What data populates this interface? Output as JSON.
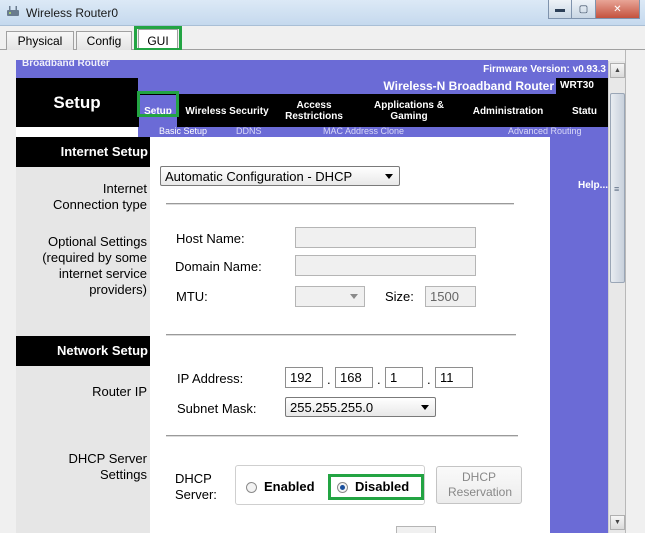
{
  "window": {
    "title": "Wireless Router0",
    "buttons": {
      "minimize": "▬",
      "maximize": "▢",
      "close": "✕"
    }
  },
  "tabs": [
    {
      "label": "Physical",
      "active": false
    },
    {
      "label": "Config",
      "active": false
    },
    {
      "label": "GUI",
      "active": true
    }
  ],
  "router": {
    "brand_partial": "Broadband Router",
    "firmware": "Firmware Version: v0.93.3",
    "product": "Wireless-N Broadband Router",
    "model": "WRT30",
    "section_title": "Setup",
    "menu": [
      {
        "label": "Setup",
        "active": true
      },
      {
        "label": "Wireless Security",
        "active": false
      },
      {
        "label": "Access Restrictions",
        "active": false
      },
      {
        "label": "Applications & Gaming",
        "active": false
      },
      {
        "label": "Administration",
        "active": false
      },
      {
        "label": "Statu",
        "active": false
      }
    ],
    "submenu": [
      {
        "label": "Basic Setup",
        "active": true
      },
      {
        "label": "DDNS",
        "active": false
      },
      {
        "label": "MAC Address Clone",
        "active": false
      },
      {
        "label": "Advanced Routing",
        "active": false
      }
    ],
    "help_link": "Help..."
  },
  "internet_setup": {
    "heading": "Internet Setup",
    "conn_type_label": "Internet Connection type",
    "conn_type_value": "Automatic Configuration - DHCP",
    "optional_label": "Optional Settings (required by some internet service providers)",
    "host_name_label": "Host Name:",
    "host_name_value": "",
    "domain_name_label": "Domain Name:",
    "domain_name_value": "",
    "mtu_label": "MTU:",
    "mtu_value": "",
    "size_label": "Size:",
    "size_value": "1500"
  },
  "network_setup": {
    "heading": "Network Setup",
    "router_ip_label": "Router IP",
    "ip_label": "IP Address:",
    "ip": [
      "192",
      "168",
      "1",
      "11"
    ],
    "dot": ".",
    "subnet_label": "Subnet Mask:",
    "subnet_value": "255.255.255.0",
    "dhcp_settings_label": "DHCP Server Settings",
    "dhcp_server_label": "DHCP Server:",
    "enabled_label": "Enabled",
    "disabled_label": "Disabled",
    "dhcp_selected": "Disabled",
    "reservation_button": "DHCP Reservation"
  },
  "colors": {
    "highlight": "#23a443",
    "router_accent": "#6b6bd6",
    "router_nav": "#000000"
  }
}
